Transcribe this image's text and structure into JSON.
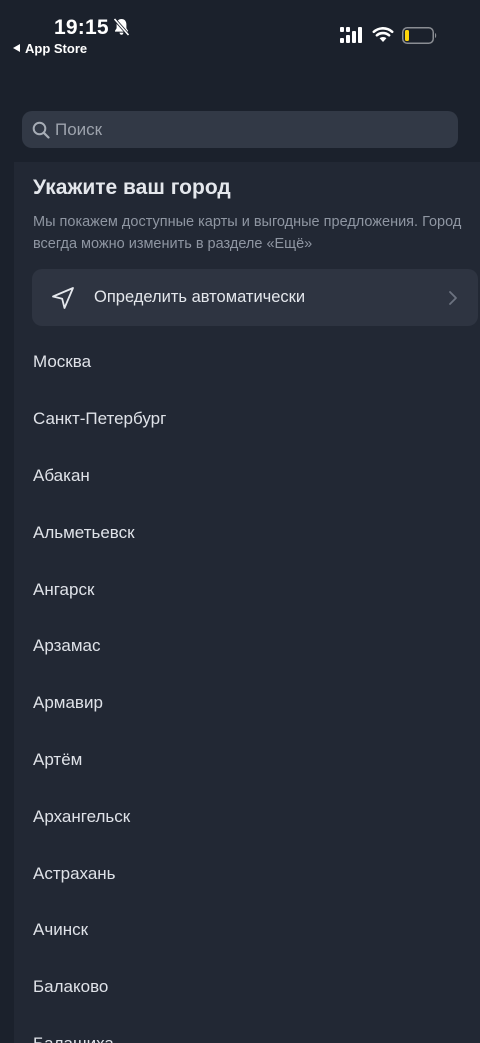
{
  "status_bar": {
    "time": "19:15",
    "back_app": "App Store",
    "bell_icon": "bell-slash-icon",
    "battery_color": "#ffd60a"
  },
  "search": {
    "placeholder": "Поиск",
    "value": ""
  },
  "header": {
    "title": "Укажите ваш город",
    "subtitle": "Мы покажем доступные карты и выгодные предложения. Город всегда можно изменить в разделе «Ещё»"
  },
  "auto_detect": {
    "label": "Определить автоматически",
    "icon": "location-arrow-icon"
  },
  "cities": [
    "Москва",
    "Санкт-Петербург",
    "Абакан",
    "Альметьевск",
    "Ангарск",
    "Арзамас",
    "Армавир",
    "Артём",
    "Архангельск",
    "Астрахань",
    "Ачинск",
    "Балаково",
    "Балашиха"
  ]
}
